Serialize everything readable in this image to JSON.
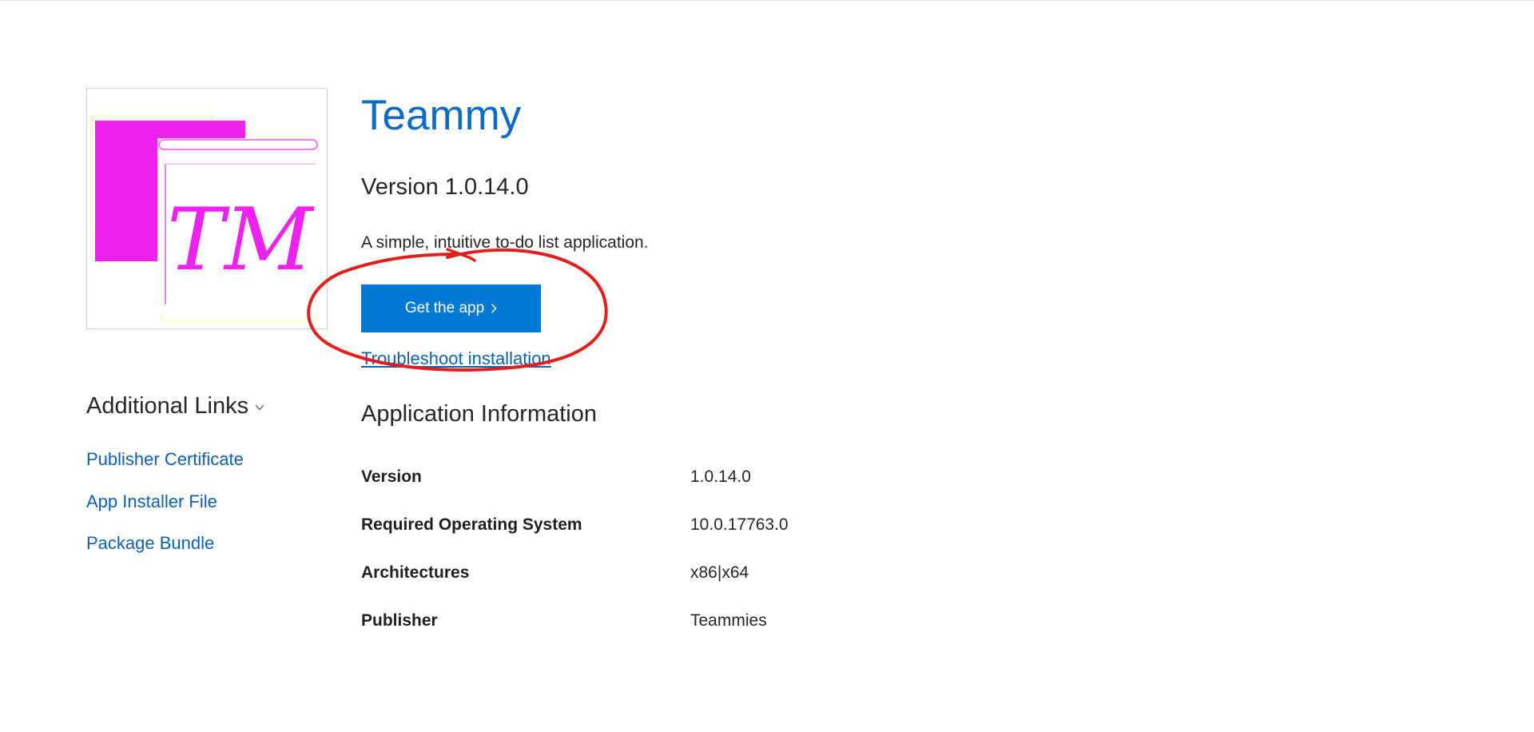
{
  "app": {
    "name": "Teammy",
    "version_line": "Version 1.0.14.0",
    "description": "A simple, intuitive to-do list application.",
    "logo_text": "TM"
  },
  "actions": {
    "get_app_label": "Get the app",
    "troubleshoot_label": "Troubleshoot installation"
  },
  "sidebar": {
    "title": "Additional Links",
    "links": [
      {
        "label": "Publisher Certificate"
      },
      {
        "label": "App Installer File"
      },
      {
        "label": "Package Bundle"
      }
    ]
  },
  "info": {
    "title": "Application Information",
    "rows": [
      {
        "key": "Version",
        "value": "1.0.14.0"
      },
      {
        "key": "Required Operating System",
        "value": "10.0.17763.0"
      },
      {
        "key": "Architectures",
        "value": "x86|x64"
      },
      {
        "key": "Publisher",
        "value": "Teammies"
      }
    ]
  },
  "icons": {
    "dropdown": "chevron-down-icon",
    "button_arrow": "chevron-right-icon",
    "logo": "app-logo-icon"
  },
  "colors": {
    "accent": "#0078d4",
    "title": "#0b6bc6",
    "link": "#0f5fb3",
    "logo_magenta": "#ee22ee",
    "annotation_red": "#e0201e"
  }
}
